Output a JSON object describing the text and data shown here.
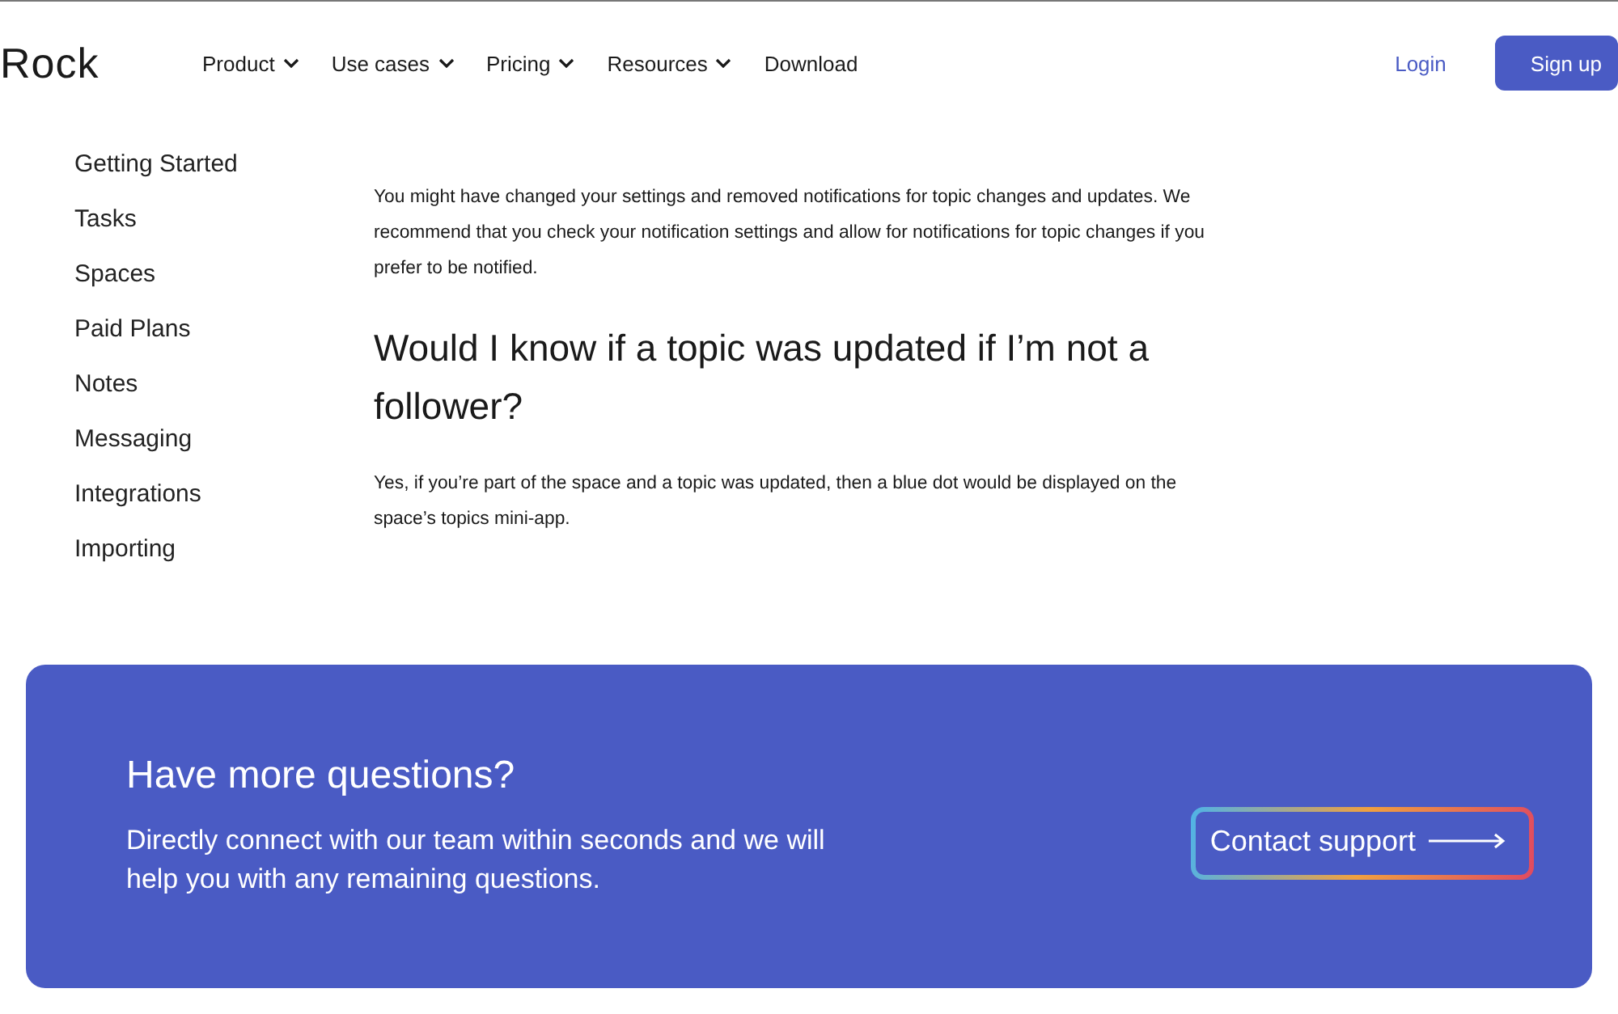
{
  "header": {
    "logo": "Rock",
    "nav": [
      {
        "label": "Product",
        "dropdown": true
      },
      {
        "label": "Use cases",
        "dropdown": true
      },
      {
        "label": "Pricing",
        "dropdown": true
      },
      {
        "label": "Resources",
        "dropdown": true
      },
      {
        "label": "Download",
        "dropdown": false
      }
    ],
    "login": "Login",
    "signup": "Sign up"
  },
  "sidebar": {
    "items": [
      "Getting Started",
      "Tasks",
      "Spaces",
      "Paid Plans",
      "Notes",
      "Messaging",
      "Integrations",
      "Importing"
    ]
  },
  "article": {
    "blocks": [
      {
        "kind": "paragraph",
        "text": "You might have changed your settings and removed notifications for topic changes and updates. We recommend that you check your notification settings and allow for notifications for topic changes if you prefer to be notified."
      },
      {
        "kind": "heading",
        "text": "Would I know if a topic was updated if I’m not a follower?"
      },
      {
        "kind": "paragraph",
        "text": "Yes, if you’re part of the space and a topic was updated, then a blue dot would be displayed on the space’s topics mini-app."
      }
    ]
  },
  "cta": {
    "title": "Have more questions?",
    "text": "Directly connect with our team within seconds and we will help you with any remaining questions.",
    "button": "Contact support"
  }
}
